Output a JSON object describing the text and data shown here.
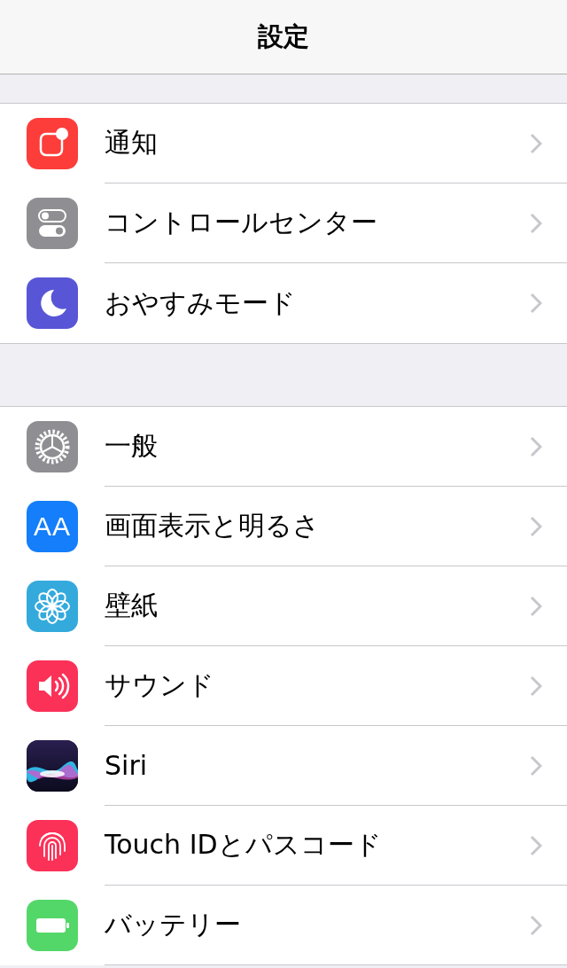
{
  "nav_bar": {
    "title": "設定"
  },
  "sections": [
    {
      "items": [
        {
          "label": "通知",
          "color": "#fc3d39"
        },
        {
          "label": "コントロールセンター",
          "color": "#8e8e93"
        },
        {
          "label": "おやすみモード",
          "color": "#5856d6"
        }
      ]
    },
    {
      "items": [
        {
          "label": "一般",
          "color": "#8e8e93"
        },
        {
          "label": "画面表示と明るさ",
          "color": "#147efb",
          "icon_text": "AA"
        },
        {
          "label": "壁紙",
          "color": "#34aadc"
        },
        {
          "label": "サウンド",
          "color": "#fc3158"
        },
        {
          "label": "Siri",
          "color": "#1c1c3a"
        },
        {
          "label": "Touch IDとパスコード",
          "color": "#fc3158"
        },
        {
          "label": "バッテリー",
          "color": "#53d769"
        }
      ]
    }
  ]
}
